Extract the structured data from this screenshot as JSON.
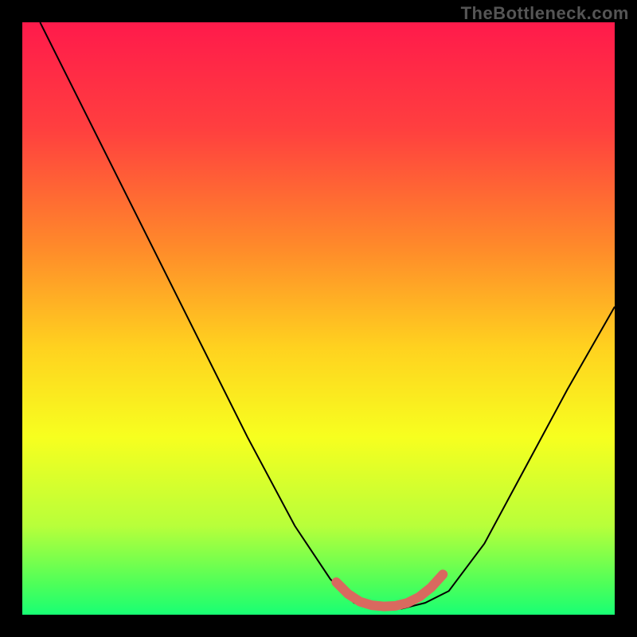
{
  "watermark": "TheBottleneck.com",
  "chart_data": {
    "type": "line",
    "title": "",
    "xlabel": "",
    "ylabel": "",
    "xlim": [
      0,
      100
    ],
    "ylim": [
      0,
      100
    ],
    "gradient_stops": [
      {
        "offset": 0,
        "color": "#ff1a4b"
      },
      {
        "offset": 18,
        "color": "#ff3f3f"
      },
      {
        "offset": 38,
        "color": "#ff8a2a"
      },
      {
        "offset": 55,
        "color": "#ffd21f"
      },
      {
        "offset": 70,
        "color": "#f7ff1f"
      },
      {
        "offset": 85,
        "color": "#b8ff3a"
      },
      {
        "offset": 95,
        "color": "#4cff5a"
      },
      {
        "offset": 100,
        "color": "#18ff74"
      }
    ],
    "series": [
      {
        "name": "bottleneck-curve",
        "stroke": "#000000",
        "stroke_width": 2,
        "points": [
          {
            "x": 3,
            "y": 100
          },
          {
            "x": 6,
            "y": 94
          },
          {
            "x": 10,
            "y": 86
          },
          {
            "x": 15,
            "y": 76
          },
          {
            "x": 22,
            "y": 62
          },
          {
            "x": 30,
            "y": 46
          },
          {
            "x": 38,
            "y": 30
          },
          {
            "x": 46,
            "y": 15
          },
          {
            "x": 52,
            "y": 6
          },
          {
            "x": 56,
            "y": 2
          },
          {
            "x": 60,
            "y": 1
          },
          {
            "x": 64,
            "y": 1
          },
          {
            "x": 68,
            "y": 2
          },
          {
            "x": 72,
            "y": 4
          },
          {
            "x": 78,
            "y": 12
          },
          {
            "x": 85,
            "y": 25
          },
          {
            "x": 92,
            "y": 38
          },
          {
            "x": 100,
            "y": 52
          }
        ]
      },
      {
        "name": "optimal-highlight",
        "stroke": "#d9695f",
        "stroke_width": 12,
        "linecap": "round",
        "points": [
          {
            "x": 53,
            "y": 5.5
          },
          {
            "x": 55,
            "y": 3.5
          },
          {
            "x": 57,
            "y": 2.2
          },
          {
            "x": 59,
            "y": 1.6
          },
          {
            "x": 61,
            "y": 1.4
          },
          {
            "x": 63,
            "y": 1.5
          },
          {
            "x": 65,
            "y": 2.0
          },
          {
            "x": 67,
            "y": 3.0
          },
          {
            "x": 69,
            "y": 4.6
          },
          {
            "x": 71,
            "y": 6.8
          }
        ]
      }
    ]
  }
}
